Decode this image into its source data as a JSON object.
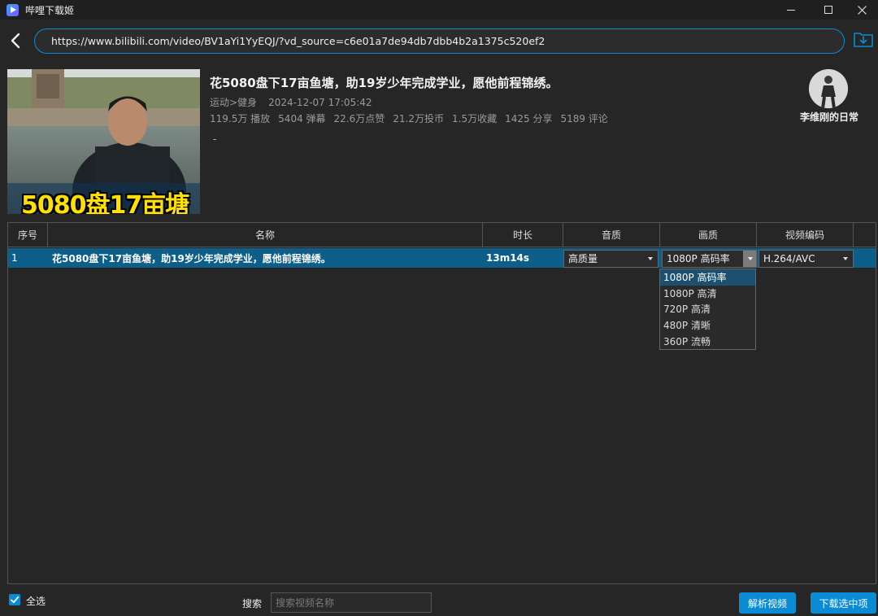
{
  "app": {
    "title": "哔哩下载姬"
  },
  "url": {
    "value": "https://www.bilibili.com/video/BV1aYi1YyEQJ/?vd_source=c6e01a7de94db7dbb4b2a1375c520ef2"
  },
  "video": {
    "thumbnail_text": "5080盘17亩塘",
    "title": "花5080盘下17亩鱼塘，助19岁少年完成学业，愿他前程锦绣。",
    "category": "运动>健身",
    "date": "2024-12-07 17:05:42",
    "stats": [
      "119.5万 播放",
      "5404 弹幕",
      "22.6万点赞",
      "21.2万投币",
      "1.5万收藏",
      "1425 分享",
      "5189 评论"
    ],
    "description": "-",
    "uploader": "李维刚的日常"
  },
  "table": {
    "headers": {
      "index": "序号",
      "name": "名称",
      "duration": "时长",
      "audio": "音质",
      "quality": "画质",
      "codec": "视频编码"
    },
    "rows": [
      {
        "index": "1",
        "name": "花5080盘下17亩鱼塘，助19岁少年完成学业，愿他前程锦绣。",
        "duration": "13m14s",
        "audio": "高质量",
        "quality": "1080P 高码率",
        "codec": "H.264/AVC"
      }
    ],
    "quality_options": [
      "1080P 高码率",
      "1080P 高清",
      "720P 高清",
      "480P 清晰",
      "360P 流畅"
    ]
  },
  "bottom": {
    "select_all": "全选",
    "search_label": "搜索",
    "search_placeholder": "搜索视频名称",
    "parse_button": "解析视频",
    "download_button": "下载选中项"
  },
  "colors": {
    "accent": "#0a8bd4",
    "row_selected": "#0d5f8a",
    "background": "#262626"
  }
}
